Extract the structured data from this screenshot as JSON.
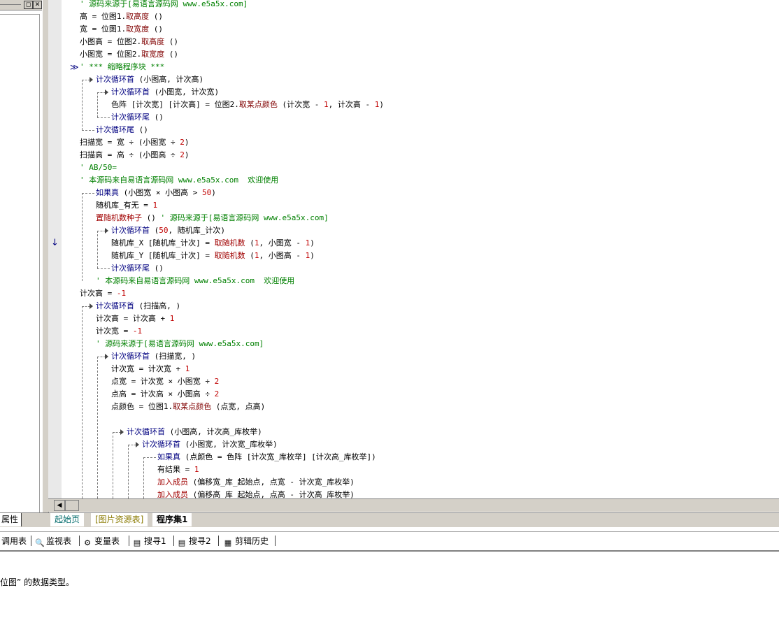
{
  "left_panel": {
    "tab_label": "属性"
  },
  "tabs": [
    {
      "label": "起始页"
    },
    {
      "label": "[图片资源表]"
    },
    {
      "label": "程序集1"
    }
  ],
  "bottom_toolbar": [
    {
      "label": "调用表",
      "icon": "call-table-icon"
    },
    {
      "label": "监视表",
      "icon": "magnifier-icon"
    },
    {
      "label": "变量表",
      "icon": "variables-icon"
    },
    {
      "label": "搜寻1",
      "icon": "search-results-icon"
    },
    {
      "label": "搜寻2",
      "icon": "search-results-icon"
    },
    {
      "label": "剪辑历史",
      "icon": "clipboard-icon"
    }
  ],
  "status_message": "位图” 的数据类型。",
  "code_lines": [
    {
      "segments": [
        {
          "t": "' 源码来源于[易语言源码网 www.e5a5x.com]",
          "c": "c"
        }
      ]
    },
    {
      "segments": [
        {
          "t": "高 = 位图1.",
          "c": "n"
        },
        {
          "t": "取高度",
          "c": "f"
        },
        {
          "t": " ()",
          "c": "n"
        }
      ]
    },
    {
      "segments": [
        {
          "t": "宽 = 位图1.",
          "c": "n"
        },
        {
          "t": "取宽度",
          "c": "f"
        },
        {
          "t": " ()",
          "c": "n"
        }
      ]
    },
    {
      "segments": [
        {
          "t": "小图高 = 位图2.",
          "c": "n"
        },
        {
          "t": "取高度",
          "c": "f"
        },
        {
          "t": " ()",
          "c": "n"
        }
      ]
    },
    {
      "segments": [
        {
          "t": "小图宽 = 位图2.",
          "c": "n"
        },
        {
          "t": "取宽度",
          "c": "f"
        },
        {
          "t": " ()",
          "c": "n"
        }
      ]
    },
    {
      "segments": [
        {
          "t": "' *** 缩略程序块 ***",
          "c": "c"
        }
      ]
    },
    {
      "segments": [
        {
          "t": "计次循环首",
          "c": "k"
        },
        {
          "t": " (小图高, 计次高)",
          "c": "n"
        }
      ]
    },
    {
      "segments": [
        {
          "t": "计次循环首",
          "c": "k"
        },
        {
          "t": " (小图宽, 计次宽)",
          "c": "n"
        }
      ]
    },
    {
      "segments": [
        {
          "t": "色阵 [计次宽] [计次高] = 位图2.",
          "c": "n"
        },
        {
          "t": "取某点颜色",
          "c": "f"
        },
        {
          "t": " (计次宽 - ",
          "c": "n"
        },
        {
          "t": "1",
          "c": "r"
        },
        {
          "t": ", 计次高 - ",
          "c": "n"
        },
        {
          "t": "1",
          "c": "r"
        },
        {
          "t": ")",
          "c": "n"
        }
      ]
    },
    {
      "segments": [
        {
          "t": "计次循环尾",
          "c": "k"
        },
        {
          "t": " ()",
          "c": "n"
        }
      ]
    },
    {
      "segments": [
        {
          "t": "计次循环尾",
          "c": "k"
        },
        {
          "t": " ()",
          "c": "n"
        }
      ]
    },
    {
      "segments": [
        {
          "t": "扫描宽 = 宽 ÷ (小图宽 ÷ ",
          "c": "n"
        },
        {
          "t": "2",
          "c": "r"
        },
        {
          "t": ")",
          "c": "n"
        }
      ]
    },
    {
      "segments": [
        {
          "t": "扫描高 = 高 ÷ (小图高 ÷ ",
          "c": "n"
        },
        {
          "t": "2",
          "c": "r"
        },
        {
          "t": ")",
          "c": "n"
        }
      ]
    },
    {
      "segments": [
        {
          "t": "' AB/50=",
          "c": "c"
        }
      ]
    },
    {
      "segments": [
        {
          "t": "' 本源码来自易语言源码网 www.e5a5x.com  欢迎使用",
          "c": "c"
        }
      ]
    },
    {
      "segments": [
        {
          "t": "如果真",
          "c": "k"
        },
        {
          "t": " (小图宽 × 小图高 > ",
          "c": "n"
        },
        {
          "t": "50",
          "c": "r"
        },
        {
          "t": ")",
          "c": "n"
        }
      ]
    },
    {
      "segments": [
        {
          "t": "随机库_有无 = ",
          "c": "n"
        },
        {
          "t": "1",
          "c": "r"
        }
      ]
    },
    {
      "segments": [
        {
          "t": "置随机数种子",
          "c": "d"
        },
        {
          "t": " () ",
          "c": "n"
        },
        {
          "t": "' 源码来源于[易语言源码网 www.e5a5x.com]",
          "c": "c"
        }
      ]
    },
    {
      "segments": [
        {
          "t": "计次循环首",
          "c": "k"
        },
        {
          "t": " (",
          "c": "n"
        },
        {
          "t": "50",
          "c": "r"
        },
        {
          "t": ", 随机库_计次)",
          "c": "n"
        }
      ]
    },
    {
      "segments": [
        {
          "t": "随机库_X [随机库_计次] = ",
          "c": "n"
        },
        {
          "t": "取随机数",
          "c": "d"
        },
        {
          "t": " (",
          "c": "n"
        },
        {
          "t": "1",
          "c": "r"
        },
        {
          "t": ", 小图宽 - ",
          "c": "n"
        },
        {
          "t": "1",
          "c": "r"
        },
        {
          "t": ")",
          "c": "n"
        }
      ]
    },
    {
      "segments": [
        {
          "t": "随机库_Y [随机库_计次] = ",
          "c": "n"
        },
        {
          "t": "取随机数",
          "c": "d"
        },
        {
          "t": " (",
          "c": "n"
        },
        {
          "t": "1",
          "c": "r"
        },
        {
          "t": ", 小图高 - ",
          "c": "n"
        },
        {
          "t": "1",
          "c": "r"
        },
        {
          "t": ")",
          "c": "n"
        }
      ]
    },
    {
      "segments": [
        {
          "t": "计次循环尾",
          "c": "k"
        },
        {
          "t": " ()",
          "c": "n"
        }
      ]
    },
    {
      "segments": [
        {
          "t": "' 本源码来自易语言源码网 www.e5a5x.com  欢迎使用",
          "c": "c"
        }
      ]
    },
    {
      "segments": [
        {
          "t": "计次高 = ",
          "c": "n"
        },
        {
          "t": "-1",
          "c": "r"
        }
      ]
    },
    {
      "segments": [
        {
          "t": "计次循环首",
          "c": "k"
        },
        {
          "t": " (扫描高, )",
          "c": "n"
        }
      ]
    },
    {
      "segments": [
        {
          "t": "计次高 = 计次高 + ",
          "c": "n"
        },
        {
          "t": "1",
          "c": "r"
        }
      ]
    },
    {
      "segments": [
        {
          "t": "计次宽 = ",
          "c": "n"
        },
        {
          "t": "-1",
          "c": "r"
        }
      ]
    },
    {
      "segments": [
        {
          "t": "' 源码来源于[易语言源码网 www.e5a5x.com]",
          "c": "c"
        }
      ]
    },
    {
      "segments": [
        {
          "t": "计次循环首",
          "c": "k"
        },
        {
          "t": " (扫描宽, )",
          "c": "n"
        }
      ]
    },
    {
      "segments": [
        {
          "t": "计次宽 = 计次宽 + ",
          "c": "n"
        },
        {
          "t": "1",
          "c": "r"
        }
      ]
    },
    {
      "segments": [
        {
          "t": "点宽 = 计次宽 × 小图宽 ÷ ",
          "c": "n"
        },
        {
          "t": "2",
          "c": "r"
        }
      ]
    },
    {
      "segments": [
        {
          "t": "点高 = 计次高 × 小图高 ÷ ",
          "c": "n"
        },
        {
          "t": "2",
          "c": "r"
        }
      ]
    },
    {
      "segments": [
        {
          "t": "点颜色 = 位图1.",
          "c": "n"
        },
        {
          "t": "取某点颜色",
          "c": "f"
        },
        {
          "t": " (点宽, 点高)",
          "c": "n"
        }
      ]
    },
    {
      "segments": []
    },
    {
      "segments": [
        {
          "t": "计次循环首",
          "c": "k"
        },
        {
          "t": " (小图高, 计次高_库枚举)",
          "c": "n"
        }
      ]
    },
    {
      "segments": [
        {
          "t": "计次循环首",
          "c": "k"
        },
        {
          "t": " (小图宽, 计次宽_库枚举)",
          "c": "n"
        }
      ]
    },
    {
      "segments": [
        {
          "t": "如果真",
          "c": "k"
        },
        {
          "t": " (点颜色 = 色阵 [计次宽_库枚举] [计次高_库枚举])",
          "c": "n"
        }
      ]
    },
    {
      "segments": [
        {
          "t": "有结果 = ",
          "c": "n"
        },
        {
          "t": "1",
          "c": "r"
        }
      ]
    },
    {
      "segments": [
        {
          "t": "加入成员",
          "c": "d"
        },
        {
          "t": " (偏移宽_库_起始点, 点宽 - 计次宽_库枚举)",
          "c": "n"
        }
      ]
    },
    {
      "segments": [
        {
          "t": "加入成员",
          "c": "d"
        },
        {
          "t": " (偏移高_库_起始点, 点高 - 计次高_库枚举)",
          "c": "n"
        }
      ]
    }
  ]
}
